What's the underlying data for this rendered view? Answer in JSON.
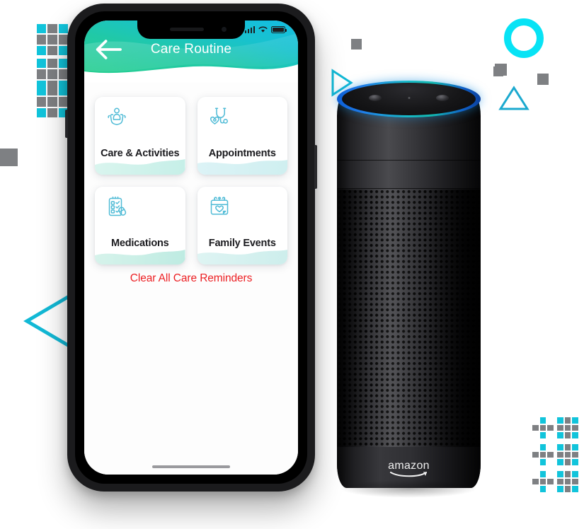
{
  "phone": {
    "status_bar": {
      "signal_icon": "signal-bars-icon",
      "wifi_icon": "wifi-icon",
      "battery_icon": "battery-full-icon"
    },
    "app_bar": {
      "back_icon": "back-arrow-icon",
      "title": "Care Routine",
      "gradient_from": "#23C99A",
      "gradient_to": "#16BEE0"
    },
    "cards": [
      {
        "label": "Care & Activities",
        "icon": "caring-hands-icon"
      },
      {
        "label": "Appointments",
        "icon": "stethoscope-heart-icon"
      },
      {
        "label": "Medications",
        "icon": "medication-checklist-icon"
      },
      {
        "label": "Family Events",
        "icon": "calendar-heart-icon"
      }
    ],
    "clear_link": {
      "label": "Clear All Care Reminders",
      "color": "#ec2024"
    },
    "home_indicator": "home-indicator"
  },
  "echo": {
    "brand": "amazon",
    "light_ring_colors": [
      "#0d5fd8",
      "#17b9c9",
      "#0a3f9e"
    ],
    "top_buttons": [
      "action-button",
      "mic-mute-button"
    ],
    "mic_dot": "microphone-dot"
  },
  "decor": {
    "accent_cyan": "#11C4DB",
    "accent_gray": "#7E8083",
    "ring_color": "#07E3F5",
    "shapes": [
      "dot-grid-top-left",
      "dot-grid-bottom-right",
      "ring-outline-top-right",
      "triangle-outline-top-right",
      "play-triangle-outline",
      "chevron-left-outline",
      "square-left-edge",
      "square-top-right",
      "square-mid-right"
    ]
  }
}
